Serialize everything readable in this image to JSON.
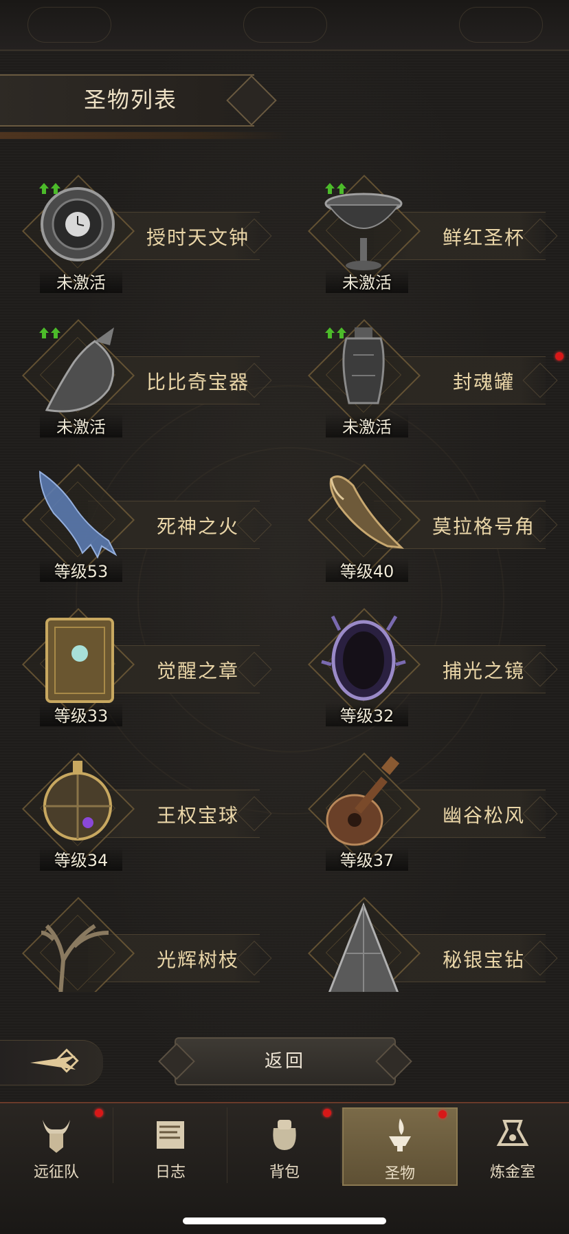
{
  "header": {
    "title": "圣物列表"
  },
  "relics": [
    {
      "name": "授时天文钟",
      "status": "未激活",
      "upgrade": true,
      "badge": false,
      "icon": "astronomical-clock-icon"
    },
    {
      "name": "鲜红圣杯",
      "status": "未激活",
      "upgrade": true,
      "badge": false,
      "icon": "chalice-icon"
    },
    {
      "name": "比比奇宝器",
      "status": "未激活",
      "upgrade": true,
      "badge": false,
      "icon": "vessel-icon"
    },
    {
      "name": "封魂罐",
      "status": "未激活",
      "upgrade": true,
      "badge": true,
      "icon": "urn-icon"
    },
    {
      "name": "死神之火",
      "status": "等级53",
      "upgrade": false,
      "badge": false,
      "icon": "spectral-hand-icon"
    },
    {
      "name": "莫拉格号角",
      "status": "等级40",
      "upgrade": false,
      "badge": false,
      "icon": "horn-icon"
    },
    {
      "name": "觉醒之章",
      "status": "等级33",
      "upgrade": false,
      "badge": false,
      "icon": "book-icon"
    },
    {
      "name": "捕光之镜",
      "status": "等级32",
      "upgrade": false,
      "badge": false,
      "icon": "mirror-icon"
    },
    {
      "name": "王权宝球",
      "status": "等级34",
      "upgrade": false,
      "badge": false,
      "icon": "orb-icon"
    },
    {
      "name": "幽谷松风",
      "status": "等级37",
      "upgrade": false,
      "badge": false,
      "icon": "lute-icon"
    },
    {
      "name": "光辉树枝",
      "status": "",
      "upgrade": false,
      "badge": false,
      "icon": "branch-icon"
    },
    {
      "name": "秘银宝钻",
      "status": "",
      "upgrade": false,
      "badge": false,
      "icon": "diamond-gem-icon"
    }
  ],
  "back_button": {
    "label": "返回"
  },
  "tabs": [
    {
      "label": "远征队",
      "icon": "horned-helmet-icon",
      "badge": true,
      "active": false
    },
    {
      "label": "日志",
      "icon": "scroll-icon",
      "badge": false,
      "active": false
    },
    {
      "label": "背包",
      "icon": "bag-icon",
      "badge": true,
      "active": false
    },
    {
      "label": "圣物",
      "icon": "brazier-icon",
      "badge": true,
      "active": true
    },
    {
      "label": "炼金室",
      "icon": "alchemy-icon",
      "badge": false,
      "active": false
    }
  ],
  "colors": {
    "badge": "#d81818",
    "upgrade_arrow": "#4cbb2a",
    "active_tab": "#7a6a48"
  }
}
